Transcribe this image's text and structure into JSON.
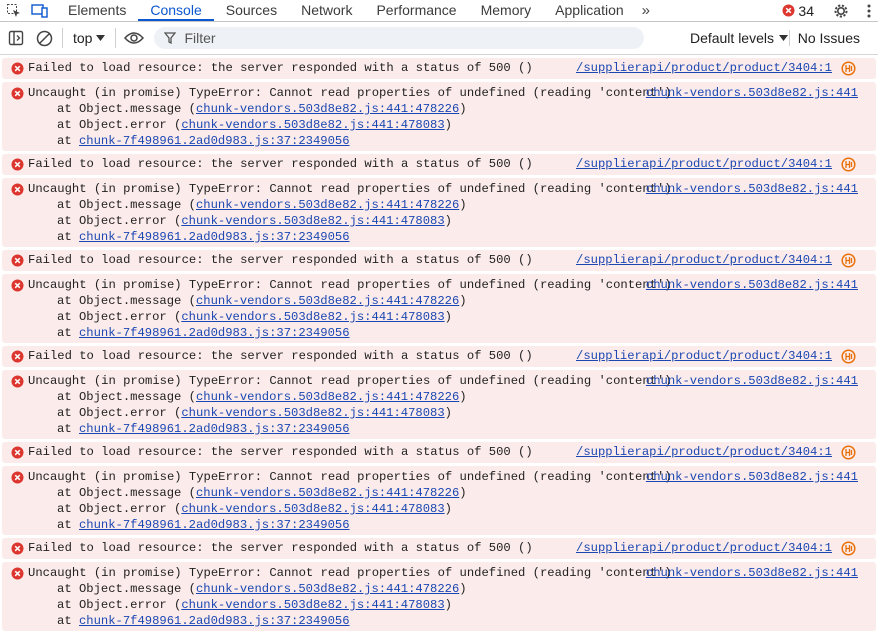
{
  "tabs": [
    "Elements",
    "Console",
    "Sources",
    "Network",
    "Performance",
    "Memory",
    "Application"
  ],
  "active_tab": "Console",
  "more_tabs_glyph": "»",
  "error_count": "34",
  "toolbar": {
    "context": "top",
    "filter_placeholder": "Filter",
    "levels": "Default levels",
    "issues": "No Issues"
  },
  "messages": {
    "resource": {
      "text": "Failed to load resource: the server responded with a status of 500 ()",
      "source": "/supplierapi/product/product/3404:1"
    },
    "uncaught": {
      "text": "Uncaught (in promise) TypeError: Cannot read properties of undefined (reading 'content')",
      "source": "chunk-vendors.503d8e82.js:441",
      "stack": [
        {
          "prefix": "at Object.message (",
          "link": "chunk-vendors.503d8e82.js:441:478226",
          "suffix": ")"
        },
        {
          "prefix": "at Object.error (",
          "link": "chunk-vendors.503d8e82.js:441:478083",
          "suffix": ")"
        },
        {
          "prefix": "at ",
          "link": "chunk-7f498961.2ad0d983.js:37:2349056",
          "suffix": ""
        }
      ]
    }
  },
  "entries": [
    "resource",
    "uncaught",
    "resource",
    "uncaught",
    "resource",
    "uncaught",
    "resource",
    "uncaught",
    "resource",
    "uncaught",
    "resource",
    "uncaught"
  ],
  "colors": {
    "accent": "#0b57d0",
    "error_bg": "#fcebeb",
    "error_icon": "#dc362e",
    "link": "#1a47b2",
    "network_icon": "#e8710a"
  },
  "icons": {
    "tabbar": [
      "inspect-element-icon",
      "device-toolbar-icon",
      "more-tabs-icon",
      "error-icon",
      "settings-gear-icon",
      "kebab-menu-icon"
    ],
    "toolbar": [
      "sidebar-toggle-icon",
      "clear-console-icon",
      "dropdown-arrow-icon",
      "live-expression-eye-icon",
      "filter-icon"
    ],
    "entry": [
      "error-icon",
      "network-request-icon"
    ]
  }
}
